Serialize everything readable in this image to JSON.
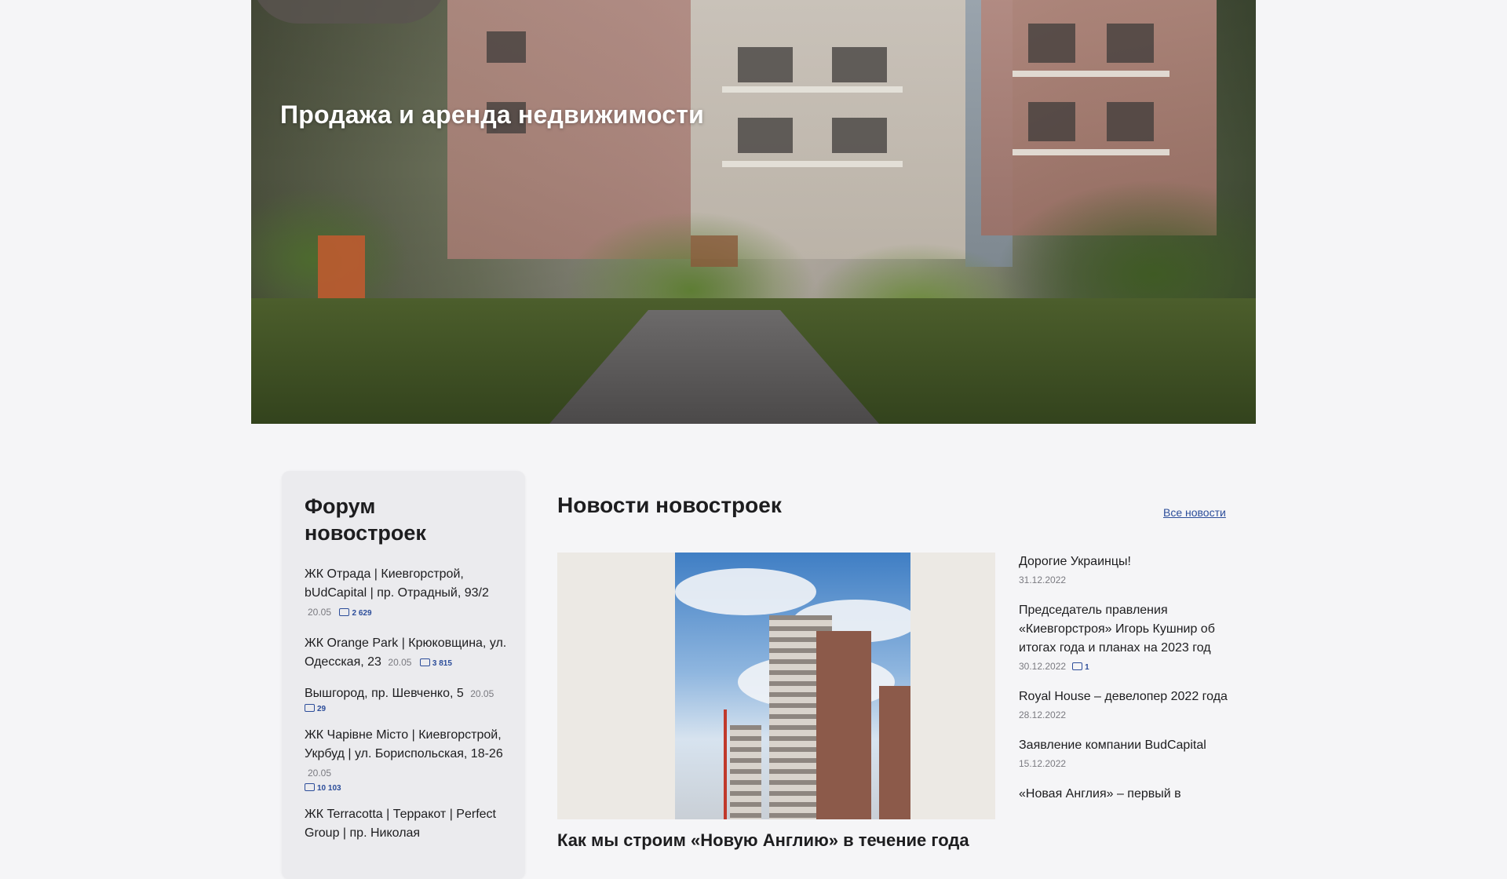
{
  "hero": {
    "title": "Продажа и аренда недвижимости"
  },
  "forum": {
    "title": "Форум новостроек",
    "items": [
      {
        "title": "ЖК Отрада | Киевгорстрой, bUdCapital | пр. Отрадный, 93/2",
        "date": "20.05",
        "count": "2 629"
      },
      {
        "title": "ЖК Orange Park | Крюковщина, ул. Одесская, 23",
        "date": "20.05",
        "count": "3 815"
      },
      {
        "title": "Вышгород, пр. Шевченко, 5",
        "date": "20.05",
        "count": "29"
      },
      {
        "title": "ЖК Чарівне Місто | Киевгорстрой, Укрбуд | ул. Бориспольская, 18-26",
        "date": "20.05",
        "count": "10 103"
      },
      {
        "title": "ЖК Terracotta | Терракот | Perfect Group | пр. Николая",
        "date": "",
        "count": ""
      }
    ]
  },
  "news": {
    "title": "Новости новостроек",
    "all_link": "Все новости",
    "main_title": "Как мы строим «Новую Англию» в течение года",
    "side": [
      {
        "title": "Дорогие Украинцы!",
        "date": "31.12.2022",
        "count": ""
      },
      {
        "title": "Председатель правления «Киевгорстроя» Игорь Кушнир об итогах года и планах на 2023 год",
        "date": "30.12.2022",
        "count": "1"
      },
      {
        "title": "Royal House – девелопер 2022 года",
        "date": "28.12.2022",
        "count": ""
      },
      {
        "title": "Заявление компании BudCapital",
        "date": "15.12.2022",
        "count": ""
      },
      {
        "title": "«Новая Англия» – первый в",
        "date": "",
        "count": ""
      }
    ]
  },
  "colors": {
    "background": "#f5f5f7",
    "accent_link": "#2c4d9a",
    "card": "#ebebee"
  }
}
